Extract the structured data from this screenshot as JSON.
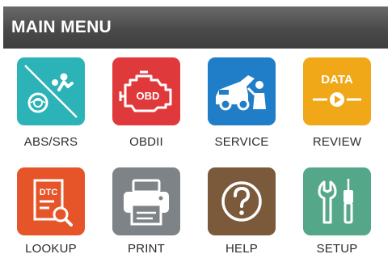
{
  "header": {
    "title": "MAIN MENU"
  },
  "menu": {
    "items": [
      {
        "label": "ABS/SRS",
        "icon": "abs-srs-icon",
        "color": "#2bb3b7"
      },
      {
        "label": "OBDII",
        "icon": "engine-obd-icon",
        "color": "#e0393b"
      },
      {
        "label": "SERVICE",
        "icon": "car-mechanic-icon",
        "color": "#1f7ec7"
      },
      {
        "label": "REVIEW",
        "icon": "data-play-icon",
        "color": "#f0a818",
        "icon_text": "DATA"
      },
      {
        "label": "LOOKUP",
        "icon": "dtc-search-icon",
        "color": "#e6542a",
        "icon_text": "DTC"
      },
      {
        "label": "PRINT",
        "icon": "printer-icon",
        "color": "#7d8386"
      },
      {
        "label": "HELP",
        "icon": "question-icon",
        "color": "#7a5a3a"
      },
      {
        "label": "SETUP",
        "icon": "tools-icon",
        "color": "#55a78a"
      }
    ]
  }
}
